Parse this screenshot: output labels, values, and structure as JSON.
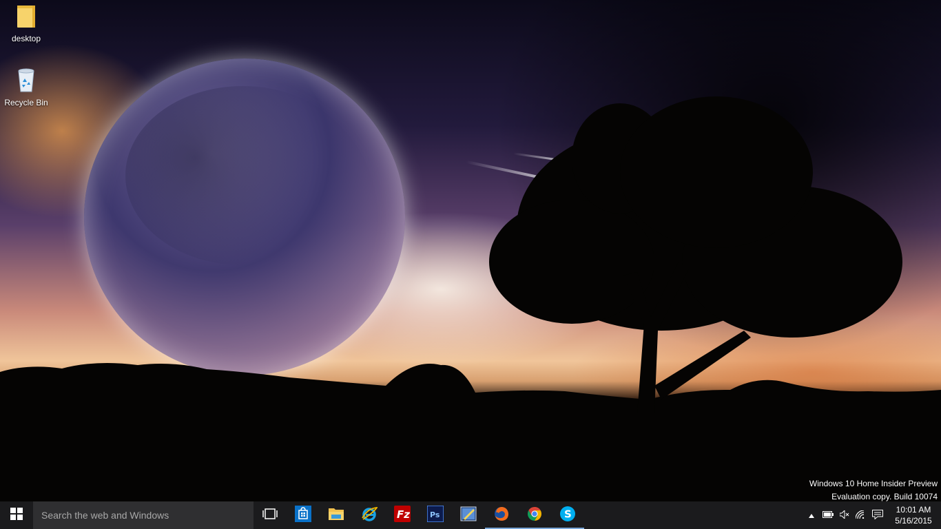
{
  "desktop": {
    "icons": [
      {
        "label": "desktop",
        "icon": "folder-icon"
      },
      {
        "label": "Recycle Bin",
        "icon": "recycle-bin-icon"
      }
    ],
    "watermark": {
      "line1": "Windows 10 Home Insider Preview",
      "line2": "Evaluation copy. Build 10074"
    }
  },
  "taskbar": {
    "search_placeholder": "Search the web and Windows",
    "pinned": [
      {
        "name": "task-view",
        "icon": "task-view-icon",
        "running": false
      },
      {
        "name": "store",
        "icon": "store-icon",
        "running": false
      },
      {
        "name": "file-explorer",
        "icon": "folder-icon",
        "running": false
      },
      {
        "name": "internet-explorer",
        "icon": "internet-explorer-icon",
        "running": false
      },
      {
        "name": "filezilla",
        "icon": "filezilla-icon",
        "running": false
      },
      {
        "name": "photoshop",
        "icon": "photoshop-icon",
        "running": false
      },
      {
        "name": "pen-app",
        "icon": "pen-app-icon",
        "running": false
      },
      {
        "name": "firefox",
        "icon": "firefox-icon",
        "running": true
      },
      {
        "name": "chrome",
        "icon": "chrome-icon",
        "running": true
      },
      {
        "name": "skype",
        "icon": "skype-icon",
        "running": true
      }
    ],
    "tray": {
      "time": "10:01 AM",
      "date": "5/16/2015"
    },
    "colors": {
      "store_blue": "#0a72c9",
      "filezilla_red": "#bf0000",
      "photoshop_navy": "#0c1b4d",
      "skype_blue": "#00aff0",
      "running_indicator": "#7aa7d8"
    }
  }
}
